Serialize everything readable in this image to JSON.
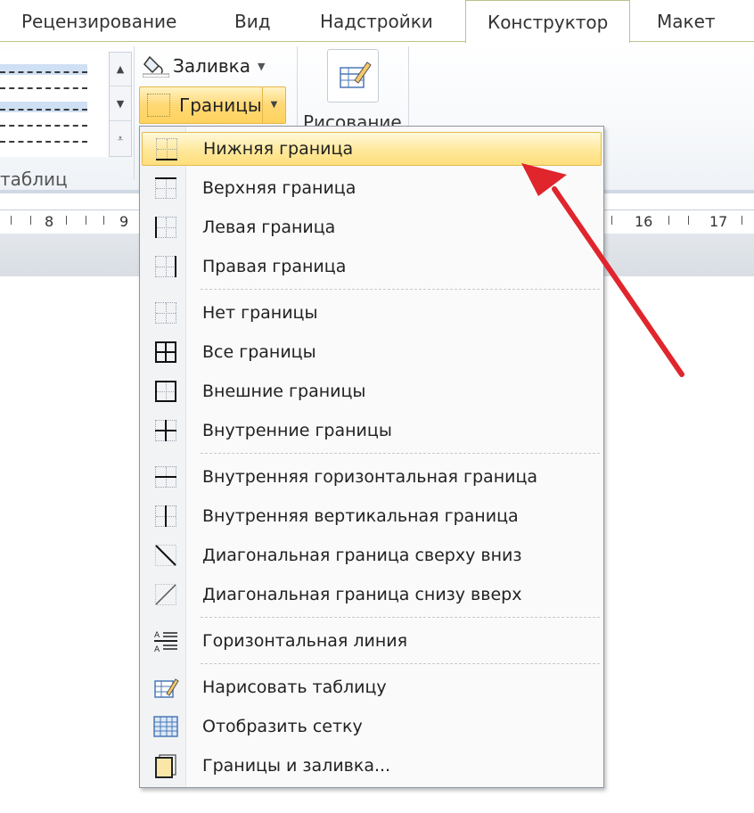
{
  "ribbon": {
    "tabs": [
      {
        "label": "Рецензирование"
      },
      {
        "label": "Вид"
      },
      {
        "label": "Надстройки"
      },
      {
        "label": "Конструктор"
      },
      {
        "label": "Макет"
      }
    ],
    "active_tab": "Конструктор",
    "group_label_partial": "таблиц",
    "fill_label": "Заливка",
    "borders_label": "Границы",
    "draw_label_partial": "Рисование"
  },
  "ruler": {
    "numbers": [
      "8",
      "9",
      "16",
      "17"
    ]
  },
  "borders_menu": {
    "items": [
      {
        "label": "Нижняя граница",
        "icon": "bottom-border-icon",
        "highlighted": true
      },
      {
        "label": "Верхняя граница",
        "icon": "top-border-icon"
      },
      {
        "label": "Левая граница",
        "icon": "left-border-icon"
      },
      {
        "label": "Правая граница",
        "icon": "right-border-icon"
      },
      {
        "label": "Нет границы",
        "icon": "no-border-icon"
      },
      {
        "label": "Все границы",
        "icon": "all-borders-icon"
      },
      {
        "label": "Внешние границы",
        "icon": "outside-borders-icon"
      },
      {
        "label": "Внутренние границы",
        "icon": "inside-borders-icon"
      },
      {
        "label": "Внутренняя горизонтальная граница",
        "icon": "inside-horizontal-border-icon"
      },
      {
        "label": "Внутренняя вертикальная граница",
        "icon": "inside-vertical-border-icon"
      },
      {
        "label": "Диагональная граница сверху вниз",
        "icon": "diagonal-down-border-icon"
      },
      {
        "label": "Диагональная граница снизу вверх",
        "icon": "diagonal-up-border-icon"
      },
      {
        "label": "Горизонтальная линия",
        "icon": "horizontal-line-icon"
      },
      {
        "label": "Нарисовать таблицу",
        "icon": "draw-table-icon"
      },
      {
        "label": "Отобразить сетку",
        "icon": "view-gridlines-icon"
      },
      {
        "label": "Границы и заливка...",
        "icon": "borders-and-shading-icon"
      }
    ]
  },
  "colors": {
    "highlight": "#ffe89b",
    "arrow": "#e0252c",
    "tab_border": "#b9c38a"
  }
}
